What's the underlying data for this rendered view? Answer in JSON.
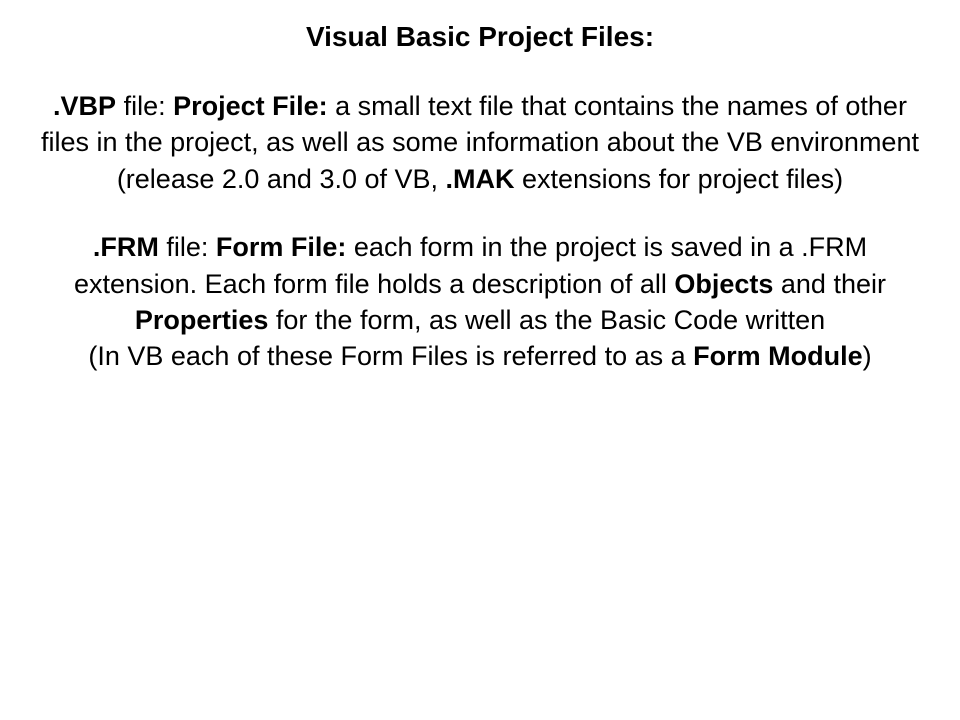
{
  "title": "Visual Basic Project Files:",
  "vbp": {
    "ext": ".VBP",
    "file_word": " file:  ",
    "label": "Project File:",
    "desc1": "  a small text file that contains the names of other files in the project, as well as some information about the VB environment",
    "note_open": "(release 2.0 and 3.0 of VB, ",
    "mak": ".MAK",
    "note_close": " extensions for project files)"
  },
  "frm": {
    "ext": ".FRM",
    "file_word": " file:  ",
    "label": "Form File:",
    "desc1": "  each form in the project is saved in a .FRM extension.  Each form file holds a description of all ",
    "objects": "Objects",
    "mid": " and their ",
    "properties": "Properties",
    "desc2": " for the form, as well as the Basic Code written",
    "note_open": "(In VB each of these Form Files is referred to as a ",
    "module": "Form Module",
    "note_close": ")"
  }
}
